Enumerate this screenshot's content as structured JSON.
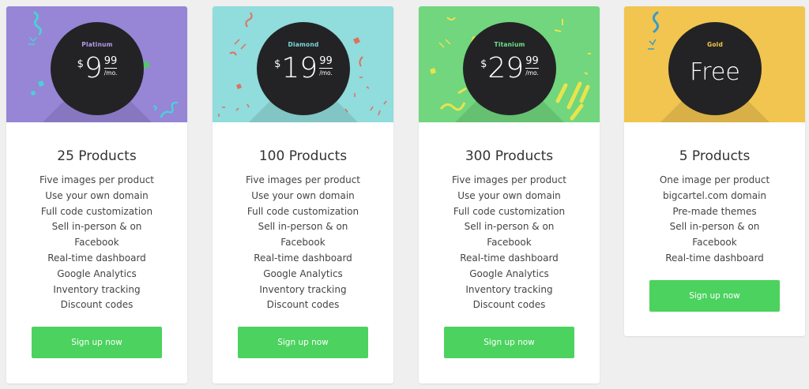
{
  "plans": [
    {
      "tier": "Platinum",
      "tier_color": "#b49be8",
      "header_color": "#9785d6",
      "currency": "$",
      "dollars": "9",
      "cents": "99",
      "per": "/mo.",
      "products": "25 Products",
      "features": [
        "Five images per product",
        "Use your own domain",
        "Full code customization",
        "Sell in-person & on Facebook",
        "Real-time dashboard",
        "Google Analytics",
        "Inventory tracking",
        "Discount codes"
      ],
      "button": "Sign up now"
    },
    {
      "tier": "Diamond",
      "tier_color": "#79d8d9",
      "header_color": "#91dcdc",
      "currency": "$",
      "dollars": "19",
      "cents": "99",
      "per": "/mo.",
      "products": "100 Products",
      "features": [
        "Five images per product",
        "Use your own domain",
        "Full code customization",
        "Sell in-person & on Facebook",
        "Real-time dashboard",
        "Google Analytics",
        "Inventory tracking",
        "Discount codes"
      ],
      "button": "Sign up now"
    },
    {
      "tier": "Titanium",
      "tier_color": "#6fe08b",
      "header_color": "#71d67e",
      "currency": "$",
      "dollars": "29",
      "cents": "99",
      "per": "/mo.",
      "products": "300 Products",
      "features": [
        "Five images per product",
        "Use your own domain",
        "Full code customization",
        "Sell in-person & on Facebook",
        "Real-time dashboard",
        "Google Analytics",
        "Inventory tracking",
        "Discount codes"
      ],
      "button": "Sign up now"
    },
    {
      "tier": "Gold",
      "tier_color": "#f2c64c",
      "header_color": "#f1c550",
      "free": "Free",
      "products": "5 Products",
      "features": [
        "One image per product",
        "bigcartel.com domain",
        "Pre-made themes",
        "Sell in-person & on Facebook",
        "Real-time dashboard"
      ],
      "button": "Sign up now"
    }
  ],
  "colors": {
    "button": "#4cd25f",
    "circle": "#232325",
    "page_bg": "#efefef"
  }
}
